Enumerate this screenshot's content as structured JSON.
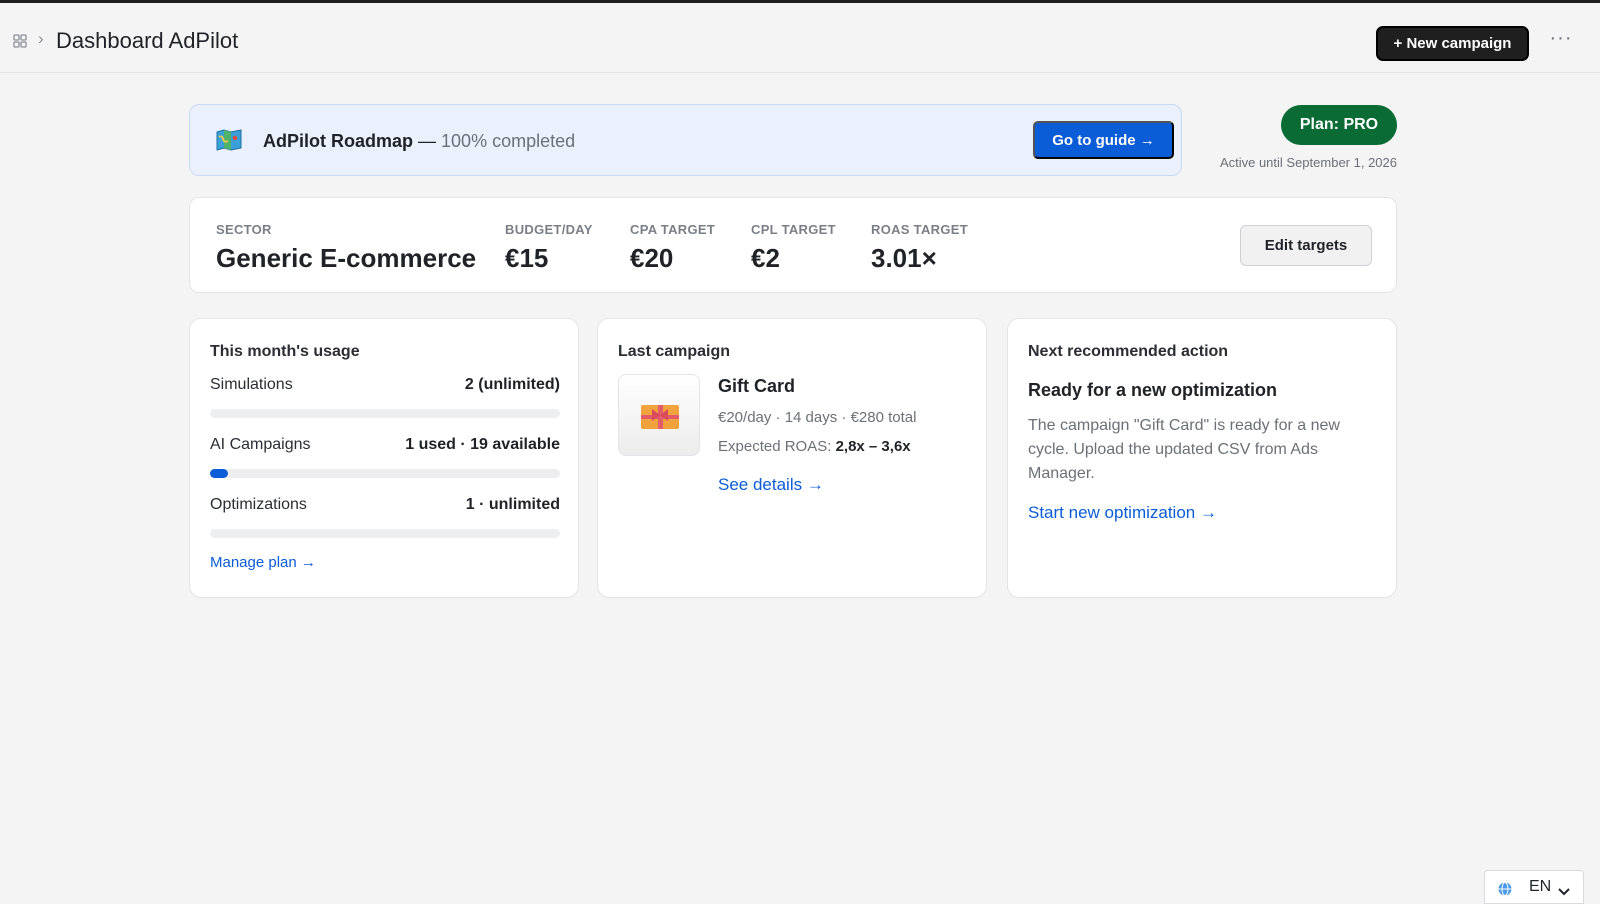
{
  "header": {
    "breadcrumb_separator": "›",
    "title": "Dashboard AdPilot",
    "new_campaign_label": "+ New campaign",
    "more_label": "···"
  },
  "roadmap": {
    "icon": "map-icon",
    "title": "AdPilot Roadmap",
    "dash": " — ",
    "status": "100% completed",
    "button_label": "Go to guide →"
  },
  "plan": {
    "badge": "Plan: PRO",
    "active_until": "Active until September 1, 2026"
  },
  "targets": {
    "sector_label": "SECTOR",
    "sector_value": "Generic E-commerce",
    "budget_label": "BUDGET/DAY",
    "budget_value": "€15",
    "cpa_label": "CPA TARGET",
    "cpa_value": "€20",
    "cpl_label": "CPL TARGET",
    "cpl_value": "€2",
    "roas_label": "ROAS TARGET",
    "roas_value": "3.01×",
    "edit_label": "Edit targets"
  },
  "usage": {
    "title": "This month's usage",
    "rows": [
      {
        "name": "Simulations",
        "value": "2 (unlimited)",
        "progress": 0
      },
      {
        "name": "AI Campaigns",
        "value": "1 used · 19 available",
        "progress": 0.05
      },
      {
        "name": "Optimizations",
        "value": "1 · unlimited",
        "progress": 0
      }
    ],
    "manage_link": "Manage plan →"
  },
  "last_campaign": {
    "title": "Last campaign",
    "thumbnail_icon": "gift-icon",
    "name": "Gift Card",
    "meta": "€20/day · 14 days · €280 total",
    "roas_label": "Expected ROAS: ",
    "roas_value": "2,8x – 3,6x",
    "details_link": "See details →"
  },
  "next_action": {
    "title": "Next recommended action",
    "heading": "Ready for a new optimization",
    "description": "The campaign \"Gift Card\" is ready for a new cycle. Upload the updated CSV from Ads Manager.",
    "link": "Start new optimization →"
  },
  "language": {
    "label": "EN"
  },
  "colors": {
    "accent": "#0b5cd7",
    "plan_green": "#0b6b34",
    "dark_button": "#1f1f1f",
    "banner_bg": "#eaf1fd"
  }
}
